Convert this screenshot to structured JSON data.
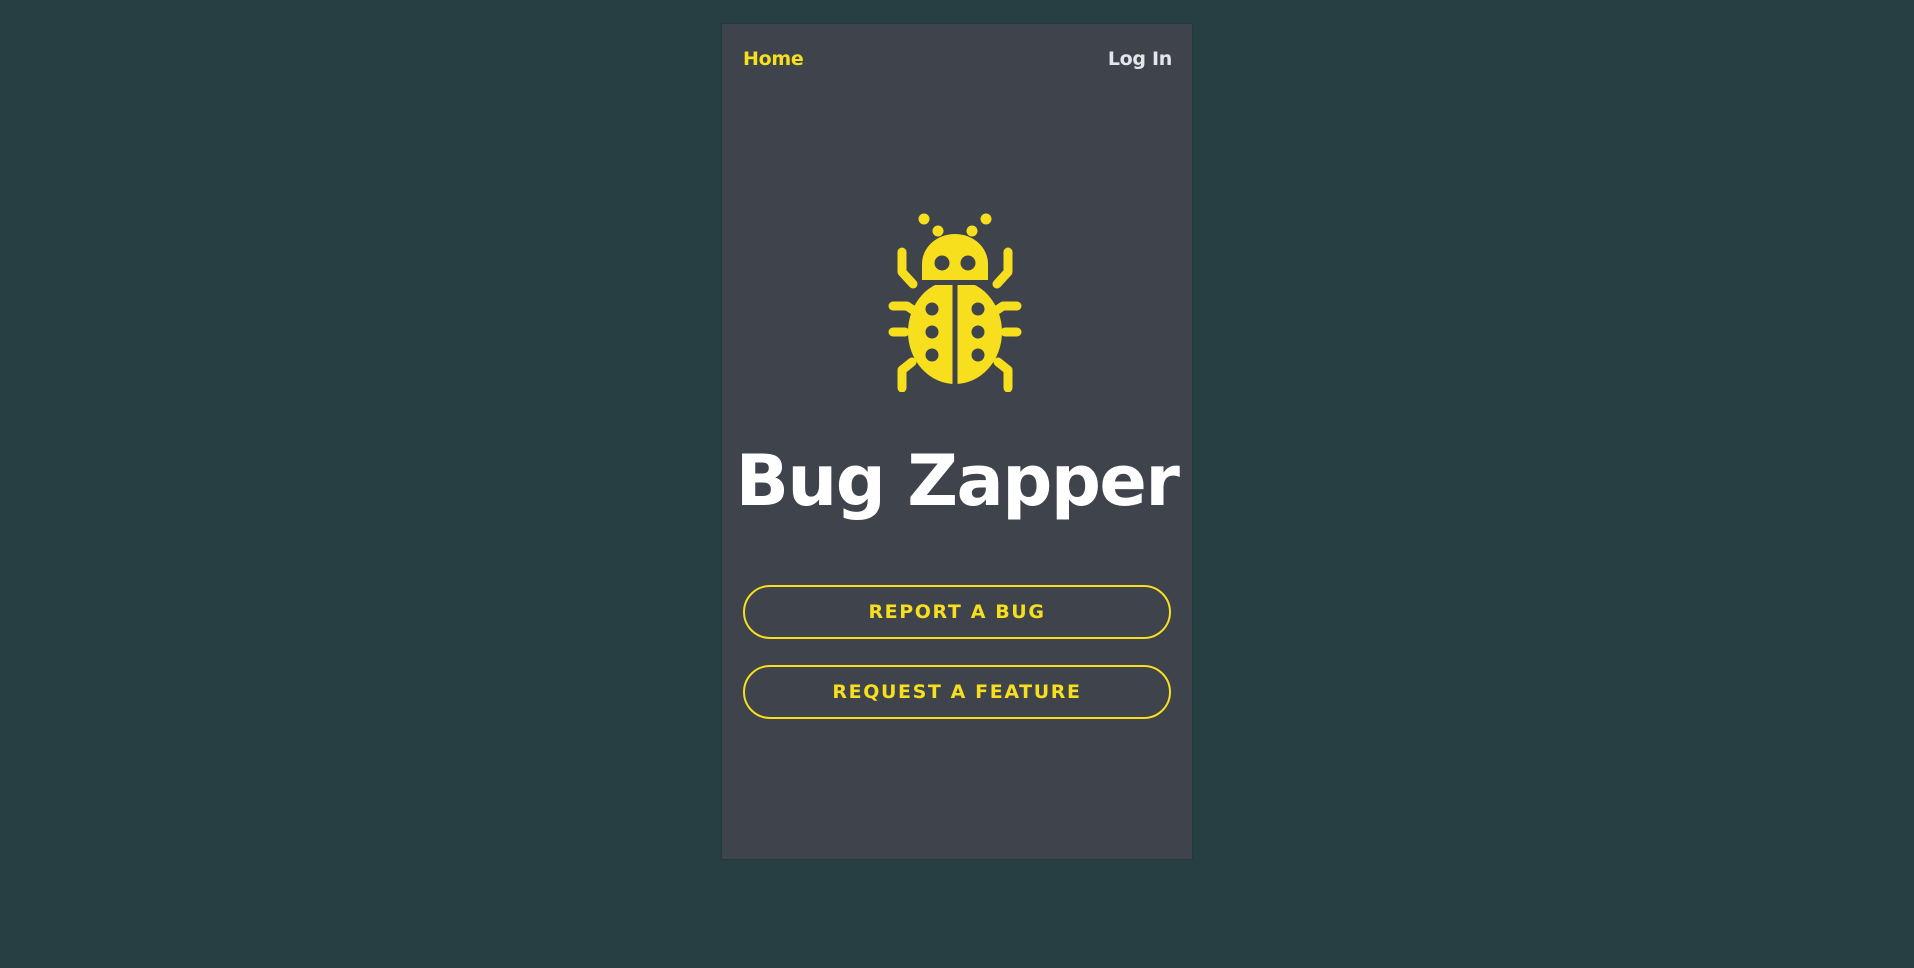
{
  "nav": {
    "home_label": "Home",
    "login_label": "Log In"
  },
  "hero": {
    "logo_icon": "bug-icon",
    "title": "Bug Zapper"
  },
  "actions": {
    "report_bug_label": "REPORT A BUG",
    "request_feature_label": "REQUEST A FEATURE"
  },
  "colors": {
    "page_background": "#273e43",
    "card_background": "#3f434c",
    "accent": "#f7df1e",
    "title_text": "#ffffff",
    "nav_text": "#e4e6ea"
  }
}
